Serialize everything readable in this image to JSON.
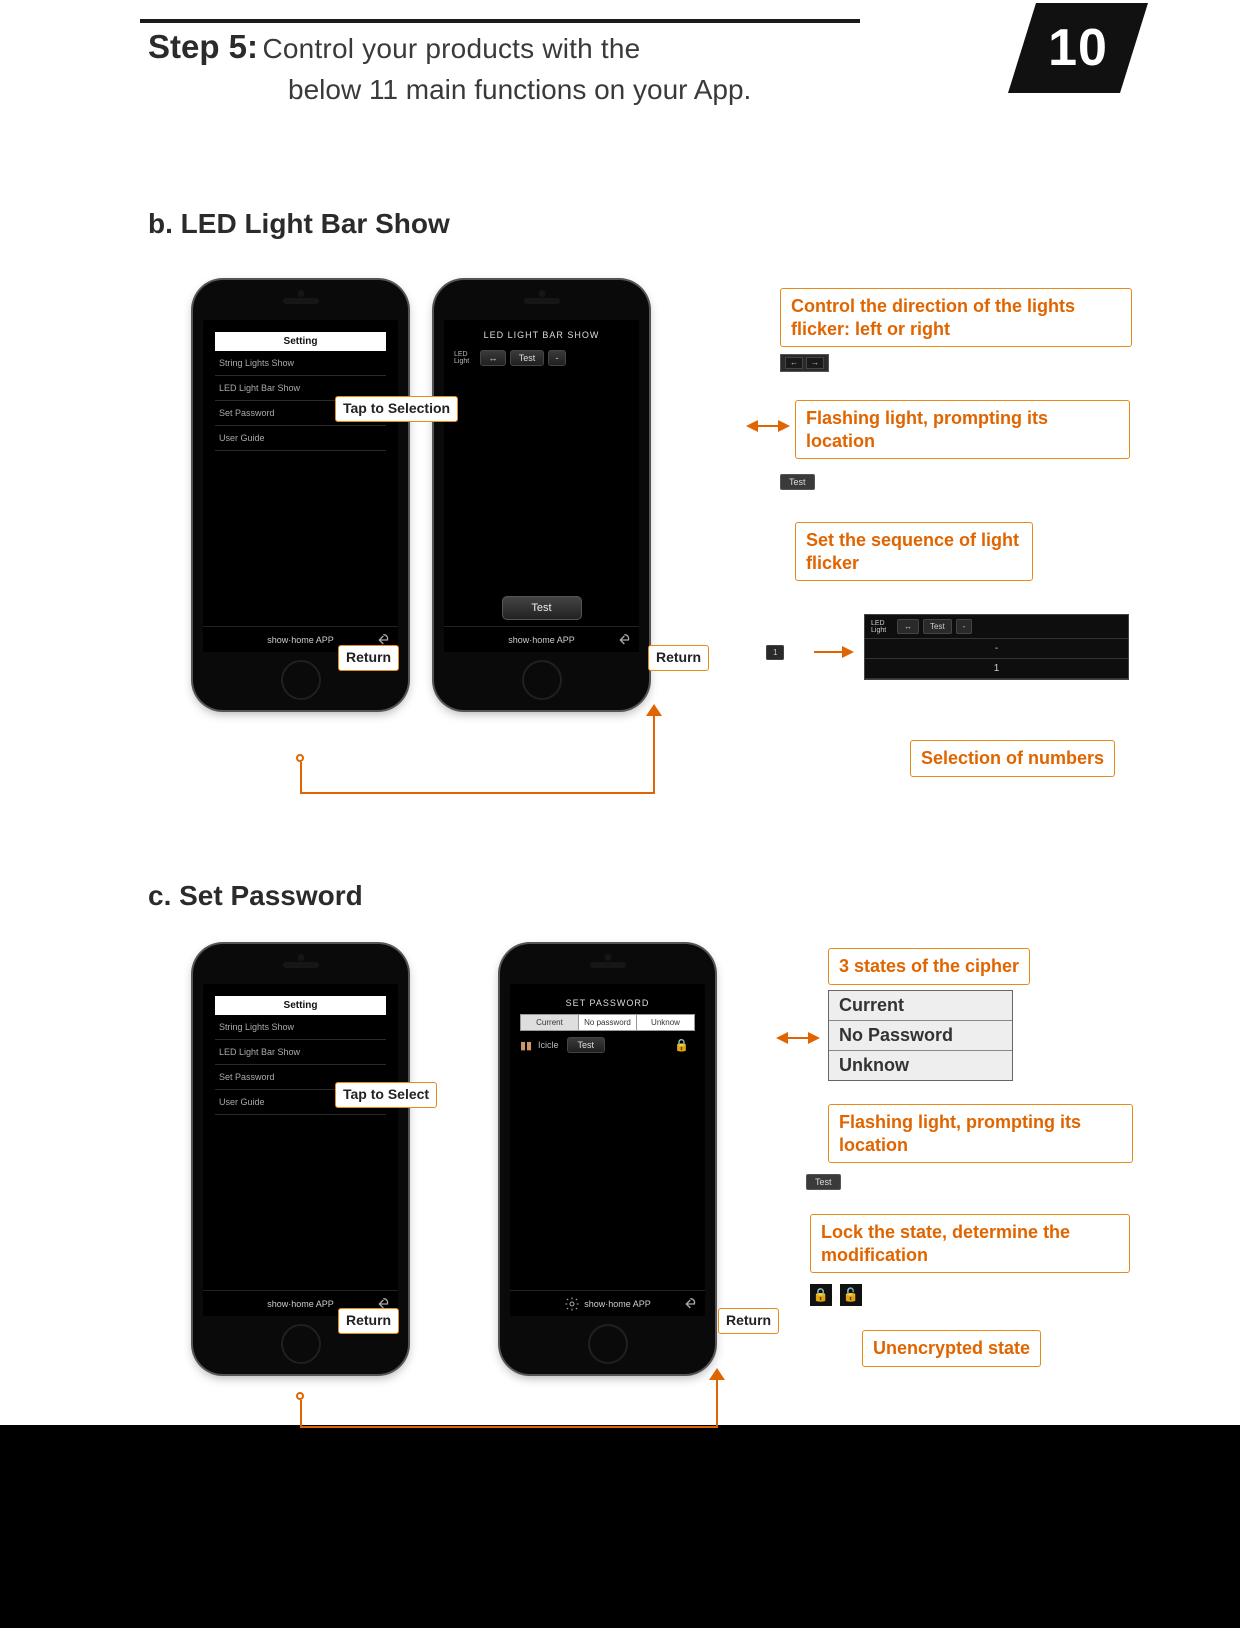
{
  "page_number": "10",
  "step": {
    "label": "Step 5:",
    "line1": "Control your products with the",
    "line2": "below 11 main functions on your App."
  },
  "section_b": {
    "title": "b. LED Light Bar Show",
    "callouts": {
      "tap_to_selection": "Tap to Selection",
      "return1": "Return",
      "return2": "Return",
      "direction": "Control the direction of the lights flicker: left or right",
      "flashing": "Flashing light, prompting its location",
      "sequence": "Set the sequence of light flicker",
      "numbers": "Selection of numbers"
    },
    "phone1": {
      "setting": "Setting",
      "menu": [
        "String Lights Show",
        "LED Light Bar Show",
        "Set Password",
        "User Guide"
      ],
      "footer": "show·home  APP"
    },
    "phone2": {
      "header": "LED LIGHT BAR SHOW",
      "led_label": "LED Light",
      "arrow_label": "↔",
      "test_small": "Test",
      "minus": "-",
      "test_big": "Test",
      "footer": "show·home  APP"
    },
    "mini": {
      "direction_left": "←",
      "direction_right": "→",
      "test": "Test",
      "row_label": "1"
    },
    "numbers_panel": {
      "led_label": "LED Light",
      "arrow": "↔",
      "test": "Test",
      "dash": "-",
      "values": [
        "-",
        "1"
      ]
    }
  },
  "section_c": {
    "title": "c. Set Password",
    "callouts": {
      "tap_to_select": "Tap to Select",
      "return1": "Return",
      "return2": "Return",
      "states": "3 states of the cipher",
      "flashing": "Flashing light, prompting its location",
      "lock": "Lock the state, determine the modification",
      "unencrypted": "Unencrypted state"
    },
    "states": [
      "Current",
      "No Password",
      "Unknow"
    ],
    "phone1": {
      "setting": "Setting",
      "menu": [
        "String Lights Show",
        "LED Light Bar Show",
        "Set Password",
        "User Guide"
      ],
      "footer": "show·home  APP"
    },
    "phone2": {
      "header": "SET PASSWORD",
      "segs": [
        "Current",
        "No password",
        "Unknow"
      ],
      "row_name": "Icicle",
      "row_test": "Test",
      "footer": "show·home  APP"
    },
    "mini": {
      "test": "Test"
    }
  }
}
